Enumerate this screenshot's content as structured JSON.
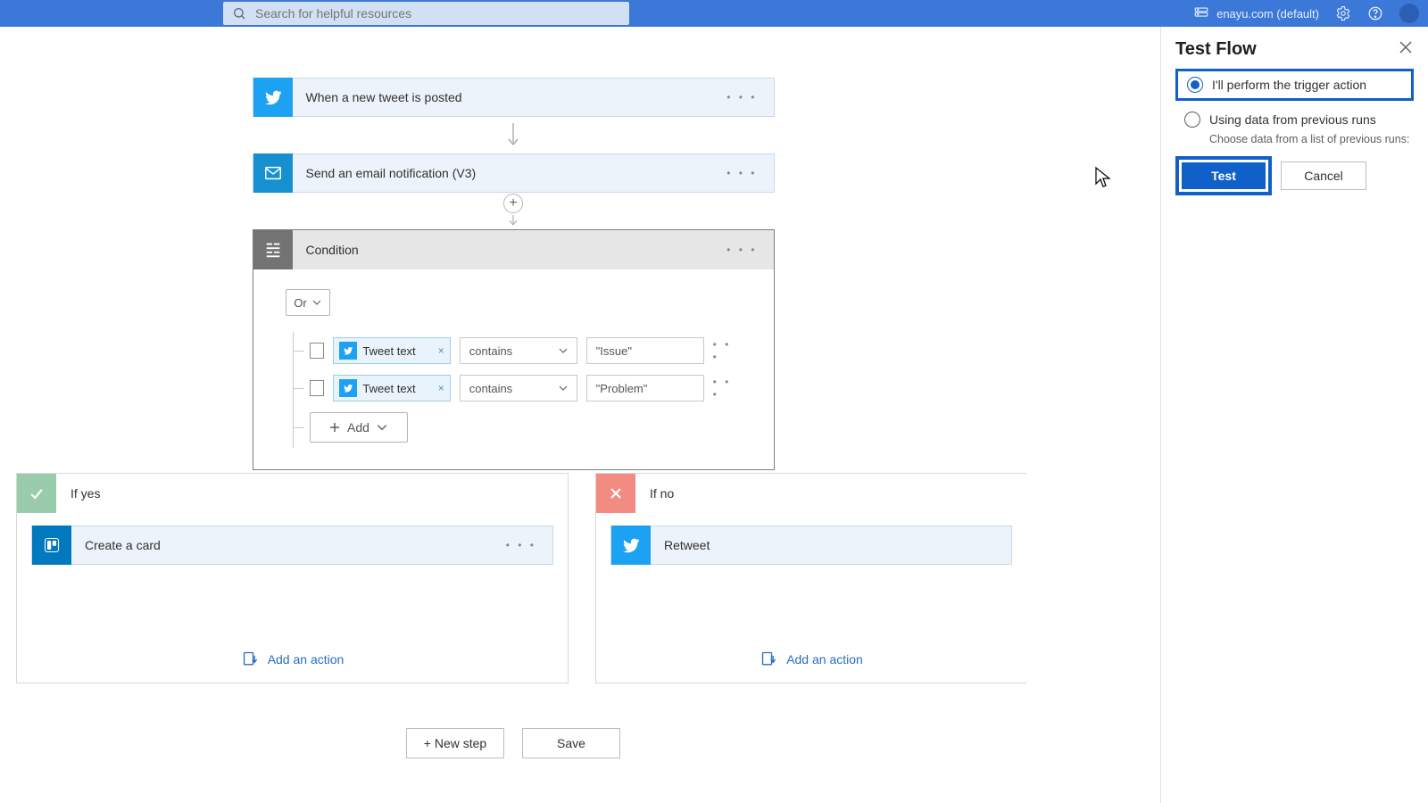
{
  "topbar": {
    "search_placeholder": "Search for helpful resources",
    "environment": "enayu.com (default)"
  },
  "flow": {
    "steps": [
      {
        "id": "trigger",
        "icon": "twitter",
        "label": "When a new tweet is posted"
      },
      {
        "id": "email",
        "icon": "mail",
        "label": "Send an email notification (V3)"
      }
    ],
    "condition": {
      "title": "Condition",
      "logic": "Or",
      "add_label": "Add",
      "rules": [
        {
          "token": "Tweet text",
          "operator": "contains",
          "value": "\"Issue\""
        },
        {
          "token": "Tweet text",
          "operator": "contains",
          "value": "\"Problem\""
        }
      ]
    },
    "branches": {
      "yes": {
        "label": "If yes",
        "step": {
          "icon": "trello",
          "label": "Create a card"
        },
        "add_action": "Add an action"
      },
      "no": {
        "label": "If no",
        "step": {
          "icon": "twitter",
          "label": "Retweet"
        },
        "add_action": "Add an action"
      }
    }
  },
  "bottom": {
    "new_step": "+ New step",
    "save": "Save"
  },
  "panel": {
    "title": "Test Flow",
    "opt_manual": "I'll perform the trigger action",
    "opt_previous": "Using data from previous runs",
    "opt_previous_hint": "Choose data from a list of previous runs:",
    "btn_test": "Test",
    "btn_cancel": "Cancel"
  }
}
